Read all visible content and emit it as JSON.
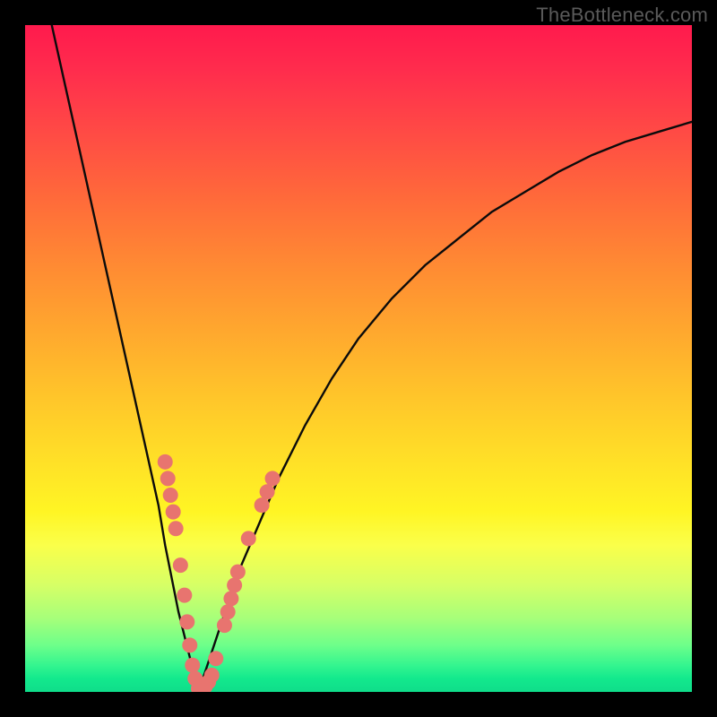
{
  "watermark": "TheBottleneck.com",
  "colors": {
    "curve": "#0b0b0b",
    "marker_fill": "#e8746f",
    "marker_stroke": "#c4554f"
  },
  "chart_data": {
    "type": "line",
    "title": "",
    "xlabel": "",
    "ylabel": "",
    "xlim": [
      0,
      100
    ],
    "ylim": [
      0,
      100
    ],
    "curve_left": {
      "name": "descending-branch",
      "x": [
        4,
        6,
        8,
        10,
        12,
        14,
        16,
        18,
        20,
        21,
        22,
        23,
        24,
        25,
        26
      ],
      "y": [
        100,
        91,
        82,
        73,
        64,
        55,
        46,
        37,
        28,
        22,
        17,
        12,
        8,
        4,
        0
      ]
    },
    "curve_right": {
      "name": "ascending-branch",
      "x": [
        26,
        28,
        30,
        32,
        35,
        38,
        42,
        46,
        50,
        55,
        60,
        65,
        70,
        75,
        80,
        85,
        90,
        95,
        100
      ],
      "y": [
        0,
        6,
        12,
        18,
        25,
        32,
        40,
        47,
        53,
        59,
        64,
        68,
        72,
        75,
        78,
        80.5,
        82.5,
        84,
        85.5
      ]
    },
    "markers": [
      {
        "x": 21.0,
        "y": 34.5
      },
      {
        "x": 21.4,
        "y": 32.0
      },
      {
        "x": 21.8,
        "y": 29.5
      },
      {
        "x": 22.2,
        "y": 27.0
      },
      {
        "x": 22.6,
        "y": 24.5
      },
      {
        "x": 23.3,
        "y": 19.0
      },
      {
        "x": 23.9,
        "y": 14.5
      },
      {
        "x": 24.3,
        "y": 10.5
      },
      {
        "x": 24.7,
        "y": 7.0
      },
      {
        "x": 25.1,
        "y": 4.0
      },
      {
        "x": 25.5,
        "y": 2.0
      },
      {
        "x": 26.0,
        "y": 0.5
      },
      {
        "x": 26.5,
        "y": 0.5
      },
      {
        "x": 27.0,
        "y": 0.8
      },
      {
        "x": 27.5,
        "y": 1.5
      },
      {
        "x": 28.0,
        "y": 2.5
      },
      {
        "x": 28.6,
        "y": 5.0
      },
      {
        "x": 29.9,
        "y": 10.0
      },
      {
        "x": 30.4,
        "y": 12.0
      },
      {
        "x": 30.9,
        "y": 14.0
      },
      {
        "x": 31.4,
        "y": 16.0
      },
      {
        "x": 31.9,
        "y": 18.0
      },
      {
        "x": 33.5,
        "y": 23.0
      },
      {
        "x": 35.5,
        "y": 28.0
      },
      {
        "x": 36.3,
        "y": 30.0
      },
      {
        "x": 37.1,
        "y": 32.0
      }
    ]
  }
}
